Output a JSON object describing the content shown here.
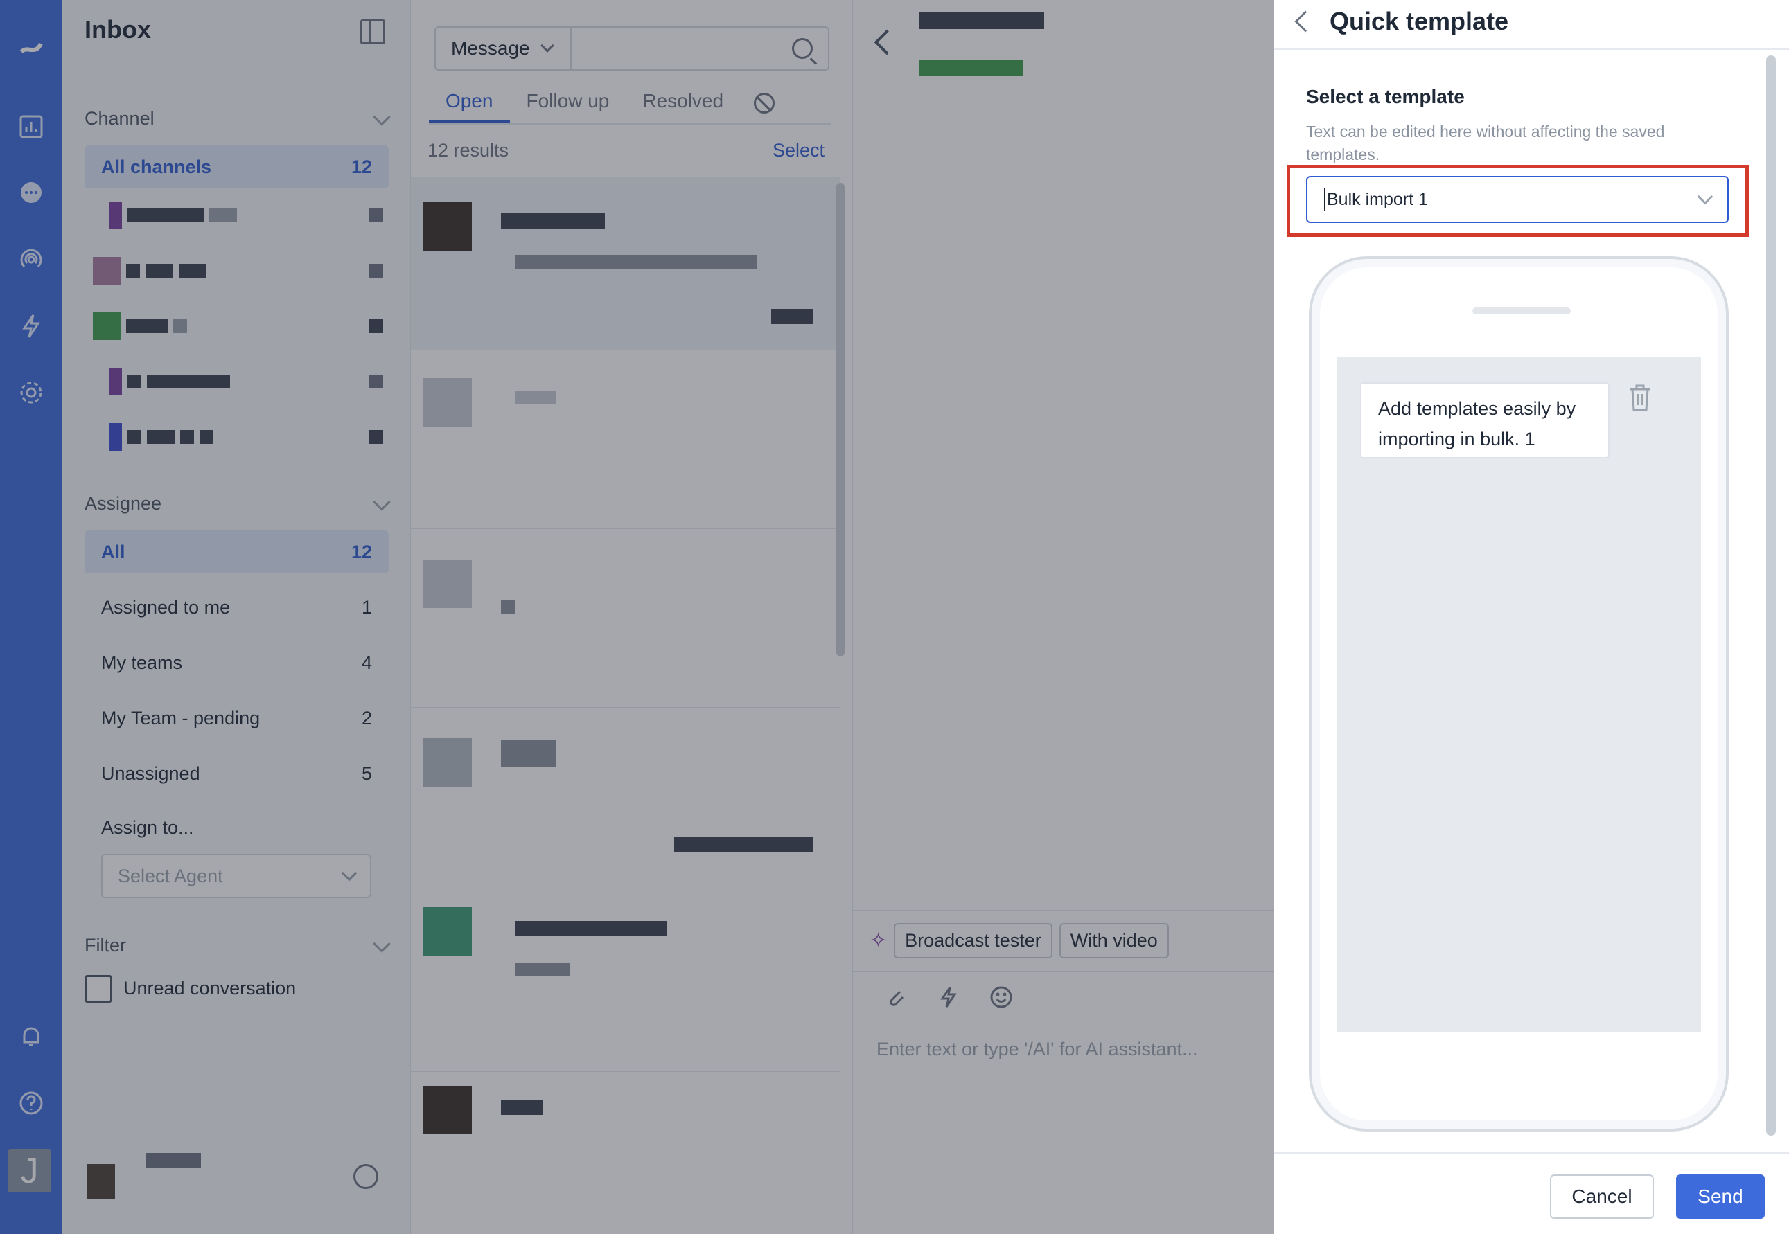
{
  "sidebar": {
    "title": "Inbox",
    "channel_section": "Channel",
    "all_channels": {
      "label": "All channels",
      "count": "12"
    },
    "assignee_section": "Assignee",
    "assignee_items": [
      {
        "label": "All",
        "count": "12"
      },
      {
        "label": "Assigned to me",
        "count": "1"
      },
      {
        "label": "My teams",
        "count": "4"
      },
      {
        "label": "My Team - pending",
        "count": "2"
      },
      {
        "label": "Unassigned",
        "count": "5"
      }
    ],
    "assign_to_label": "Assign to...",
    "select_agent_placeholder": "Select Agent",
    "filter_section": "Filter",
    "unread_label": "Unread conversation"
  },
  "user": {
    "avatar_initial": "J"
  },
  "list": {
    "search_type": "Message",
    "tabs": [
      {
        "label": "Open",
        "active": true
      },
      {
        "label": "Follow up",
        "active": false
      },
      {
        "label": "Resolved",
        "active": false
      }
    ],
    "results": "12 results",
    "select_label": "Select"
  },
  "chat": {
    "chips": [
      "Broadcast tester",
      "With video"
    ],
    "composer_placeholder": "Enter text or type '/AI' for AI assistant..."
  },
  "drawer": {
    "title": "Quick template",
    "label": "Select a template",
    "help": "Text can be edited here without affecting the saved templates.",
    "selected_template": "Bulk import 1",
    "preview_message": "Add templates easily by importing in bulk. 1",
    "cancel_label": "Cancel",
    "send_label": "Send"
  },
  "colors": {
    "accent": "#3d6bdc",
    "highlight": "#d43a2c"
  }
}
